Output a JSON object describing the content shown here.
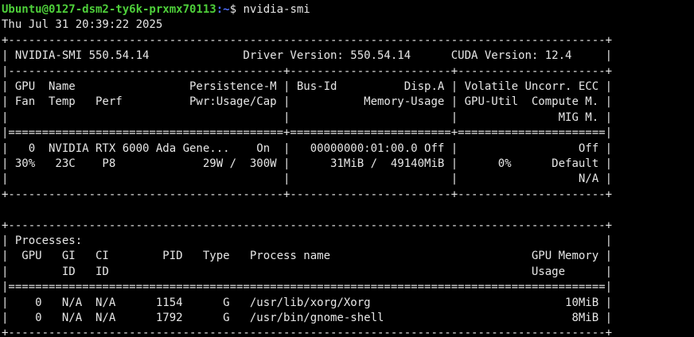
{
  "terminal": {
    "prompt": {
      "user_host": "Ubuntu@0127-dsm2-ty6k-prxmx70113",
      "path": ":~",
      "symbol": "$ ",
      "command": "nvidia-smi"
    },
    "lines": [
      "Thu Jul 31 20:39:22 2025",
      "+-----------------------------------------------------------------------------------------+",
      "| NVIDIA-SMI 550.54.14              Driver Version: 550.54.14      CUDA Version: 12.4     |",
      "|-----------------------------------------+------------------------+----------------------+",
      "| GPU  Name                 Persistence-M | Bus-Id          Disp.A | Volatile Uncorr. ECC |",
      "| Fan  Temp   Perf          Pwr:Usage/Cap |           Memory-Usage | GPU-Util  Compute M. |",
      "|                                         |                        |               MIG M. |",
      "|=========================================+========================+======================|",
      "|   0  NVIDIA RTX 6000 Ada Gene...    On  |   00000000:01:00.0 Off |                  Off |",
      "| 30%   23C    P8             29W /  300W |      31MiB /  49140MiB |      0%      Default |",
      "|                                         |                        |                  N/A |",
      "+-----------------------------------------+------------------------+----------------------+",
      "",
      "+-----------------------------------------------------------------------------------------+",
      "| Processes:                                                                              |",
      "|  GPU   GI   CI        PID   Type   Process name                              GPU Memory |",
      "|        ID   ID                                                               Usage      |",
      "|=========================================================================================|",
      "|    0   N/A  N/A      1154      G   /usr/lib/xorg/Xorg                             10MiB |",
      "|    0   N/A  N/A      1792      G   /usr/bin/gnome-shell                            8MiB |",
      "+-----------------------------------------------------------------------------------------+"
    ]
  },
  "colors": {
    "background": "#000000",
    "text": "#e6e6e6",
    "prompt_user": "#4ecf3a",
    "prompt_path": "#4f6fff"
  }
}
